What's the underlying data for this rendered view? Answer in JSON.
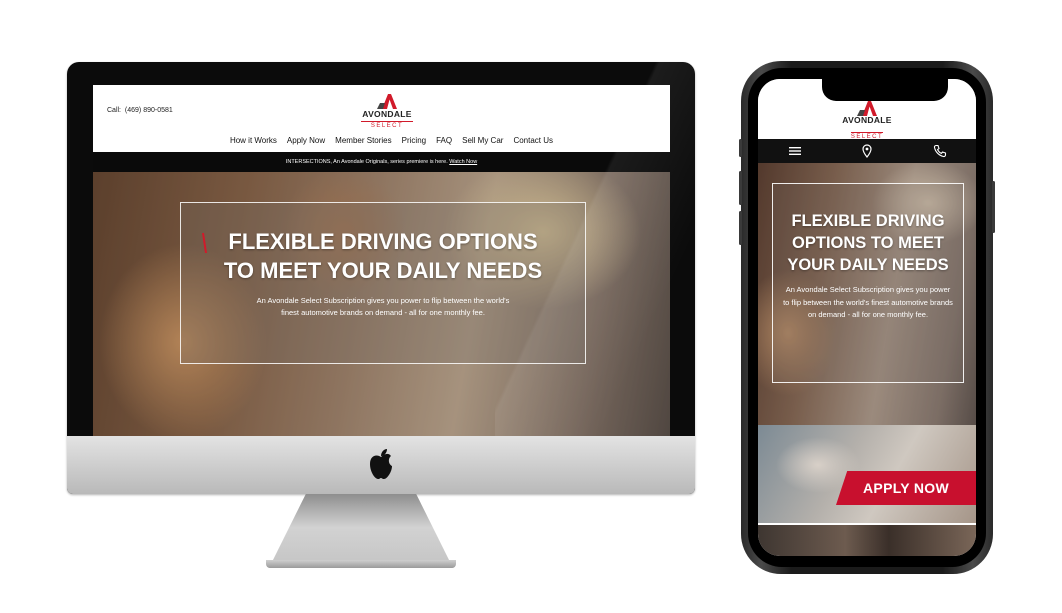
{
  "brand": {
    "name": "AVONDALE",
    "sub": "SELECT",
    "accent": "#d11a2a"
  },
  "desktop": {
    "call_label": "Call:",
    "phone": "(469) 890-0581",
    "nav": [
      "How it Works",
      "Apply Now",
      "Member Stories",
      "Pricing",
      "FAQ",
      "Sell My Car",
      "Contact Us"
    ],
    "announcement": {
      "text": "INTERSECTIONS, An Avondale Originals, series premiere is here.",
      "link": "Watch Now"
    },
    "hero": {
      "headline_line1": "FLEXIBLE DRIVING OPTIONS",
      "headline_line2": "TO MEET YOUR DAILY NEEDS",
      "body": "An Avondale Select Subscription gives you power to flip between the world's finest automotive brands on demand - all for one monthly fee."
    }
  },
  "mobile": {
    "icons": [
      "hamburger-menu-icon",
      "location-pin-icon",
      "phone-icon"
    ],
    "hero": {
      "headline_line1": "FLEXIBLE DRIVING",
      "headline_line2": "OPTIONS TO MEET",
      "headline_line3": "YOUR DAILY NEEDS",
      "body": "An Avondale Select Subscription gives you power to flip between the world's finest automotive brands on demand - all for one monthly fee."
    },
    "apply_label": "APPLY NOW"
  }
}
